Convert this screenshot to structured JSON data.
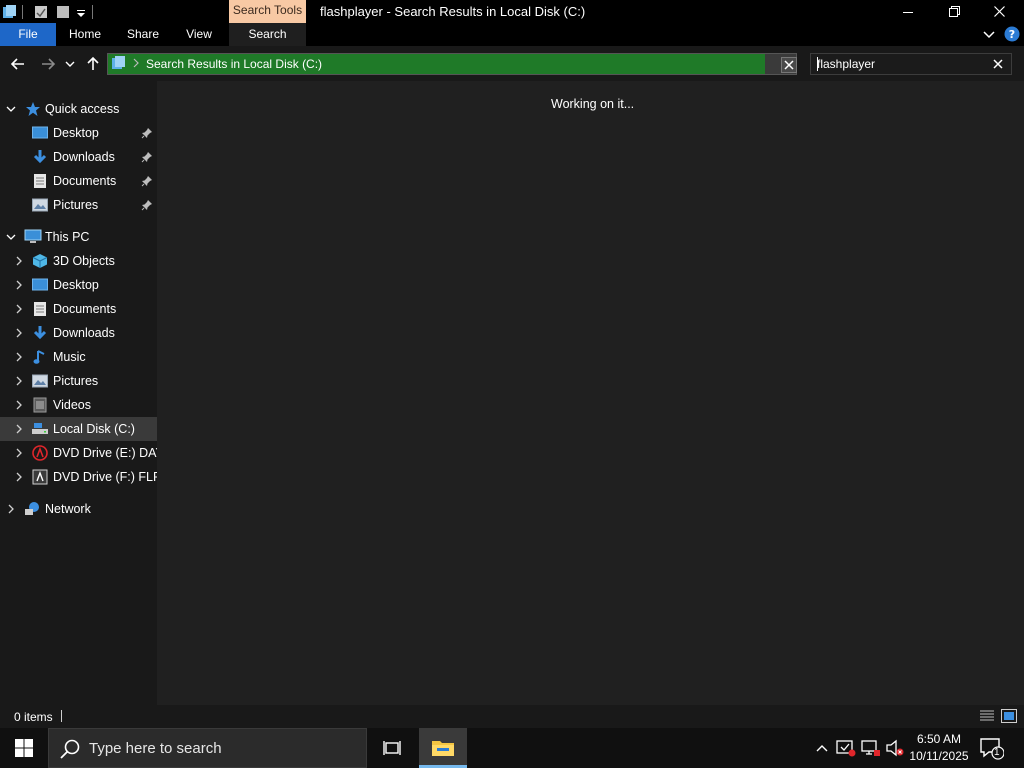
{
  "window": {
    "title": "flashplayer - Search Results in Local Disk (C:)",
    "context_tab_group": "Search Tools"
  },
  "ribbon": {
    "tabs": [
      {
        "label": "File"
      },
      {
        "label": "Home"
      },
      {
        "label": "Share"
      },
      {
        "label": "View"
      },
      {
        "label": "Search"
      }
    ]
  },
  "address": {
    "path": "Search Results in Local Disk (C:)"
  },
  "search": {
    "value": "flashplayer"
  },
  "navpane": {
    "quick_access": {
      "label": "Quick access",
      "items": [
        {
          "label": "Desktop",
          "icon": "desktop-icon"
        },
        {
          "label": "Downloads",
          "icon": "downloads-icon"
        },
        {
          "label": "Documents",
          "icon": "documents-icon"
        },
        {
          "label": "Pictures",
          "icon": "pictures-icon"
        }
      ]
    },
    "this_pc": {
      "label": "This PC",
      "items": [
        {
          "label": "3D Objects",
          "icon": "3d-objects-icon"
        },
        {
          "label": "Desktop",
          "icon": "desktop-icon"
        },
        {
          "label": "Documents",
          "icon": "documents-icon"
        },
        {
          "label": "Downloads",
          "icon": "downloads-icon"
        },
        {
          "label": "Music",
          "icon": "music-icon"
        },
        {
          "label": "Pictures",
          "icon": "pictures-icon"
        },
        {
          "label": "Videos",
          "icon": "videos-icon"
        },
        {
          "label": "Local Disk (C:)",
          "icon": "local-disk-icon"
        },
        {
          "label": "DVD Drive (E:) DAY_",
          "icon": "dvd-drive-icon"
        },
        {
          "label": "DVD Drive (F:) FLPR",
          "icon": "dvd-drive-icon"
        }
      ]
    },
    "network": {
      "label": "Network"
    }
  },
  "content": {
    "status_message": "Working on it..."
  },
  "statusbar": {
    "item_count": "0 items"
  },
  "taskbar": {
    "search_placeholder": "Type here to search",
    "time": "6:50 AM",
    "date": "10/11/2025",
    "notification_count": "1"
  },
  "colors": {
    "address_progress": "#1f7a28",
    "file_tab": "#1e67c8",
    "context_tab": "#f8c9a4",
    "selected_nav": "#3a3a3a"
  }
}
